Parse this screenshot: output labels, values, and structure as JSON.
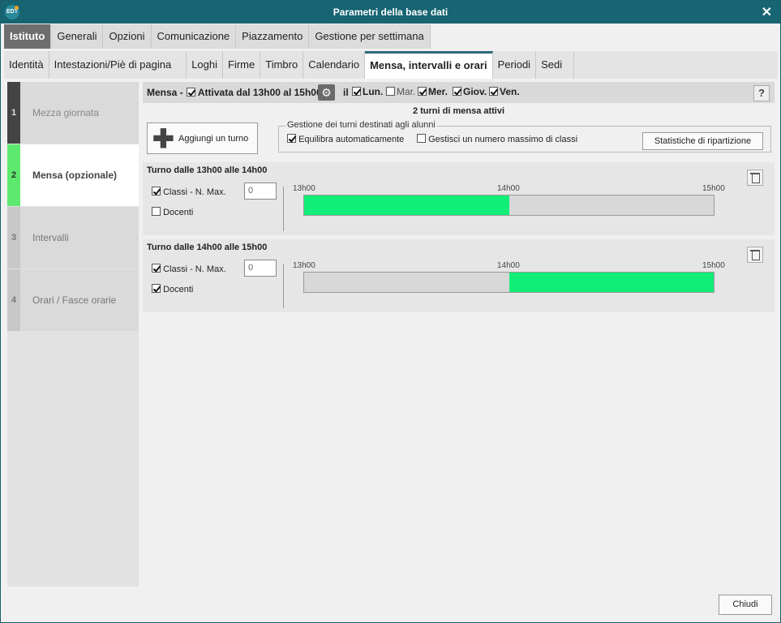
{
  "window": {
    "title": "Parametri della base dati",
    "logo": "EDT",
    "close_icon": "✕"
  },
  "tabs_primary": [
    {
      "label": "Istituto",
      "active": true
    },
    {
      "label": "Generali"
    },
    {
      "label": "Opzioni"
    },
    {
      "label": "Comunicazione"
    },
    {
      "label": "Piazzamento"
    },
    {
      "label": "Gestione per settimana"
    }
  ],
  "tabs_secondary": [
    {
      "label": "Identità"
    },
    {
      "label": "Intestazioni/Piè di pagina"
    },
    {
      "label": "Loghi"
    },
    {
      "label": "Firme"
    },
    {
      "label": "Timbro"
    },
    {
      "label": "Calendario"
    },
    {
      "label": "Mensa, intervalli e orari",
      "active": true
    },
    {
      "label": "Periodi"
    },
    {
      "label": "Sedi"
    }
  ],
  "sidebar": {
    "steps": [
      {
        "num": "1",
        "label": "Mezza giornata"
      },
      {
        "num": "2",
        "label": "Mensa (opzionale)",
        "active": true
      },
      {
        "num": "3",
        "label": "Intervalli"
      },
      {
        "num": "4",
        "label": "Orari / Fasce orarie"
      }
    ]
  },
  "mensa": {
    "prefix": "Mensa -",
    "activated_label": "Attivata dal 13h00 al 15h00",
    "il": "il",
    "days": [
      {
        "label": "Lun.",
        "checked": true
      },
      {
        "label": "Mar.",
        "checked": false
      },
      {
        "label": "Mer.",
        "checked": true
      },
      {
        "label": "Giov.",
        "checked": true
      },
      {
        "label": "Ven.",
        "checked": true
      }
    ],
    "help": "?",
    "active_count": "2 turni di mensa attivi",
    "add_turn": "Aggiungi un turno",
    "add_icon": "✚",
    "gestione": {
      "legend": "Gestione dei turni destinati agli alunni",
      "equilibra": "Equilibra automaticamente",
      "gestisci": "Gestisci un numero massimo di classi",
      "stat_button": "Statistiche di ripartizione"
    },
    "turni": [
      {
        "title": "Turno dalle 13h00 alle 14h00",
        "classi_label": "Classi - N. Max.",
        "classi_checked": true,
        "max": "0",
        "docenti_label": "Docenti",
        "docenti_checked": false,
        "ticks": [
          "13h00",
          "14h00",
          "15h00"
        ],
        "fill_start": 0,
        "fill_end": 0.5,
        "fill_color": "#11ee77"
      },
      {
        "title": "Turno dalle 14h00 alle 15h00",
        "classi_label": "Classi - N. Max.",
        "classi_checked": true,
        "max": "0",
        "docenti_label": "Docenti",
        "docenti_checked": true,
        "ticks": [
          "13h00",
          "14h00",
          "15h00"
        ],
        "fill_start": 0.5,
        "fill_end": 1,
        "fill_color": "#11ee77"
      }
    ]
  },
  "footer": {
    "close_button": "Chiudi"
  }
}
